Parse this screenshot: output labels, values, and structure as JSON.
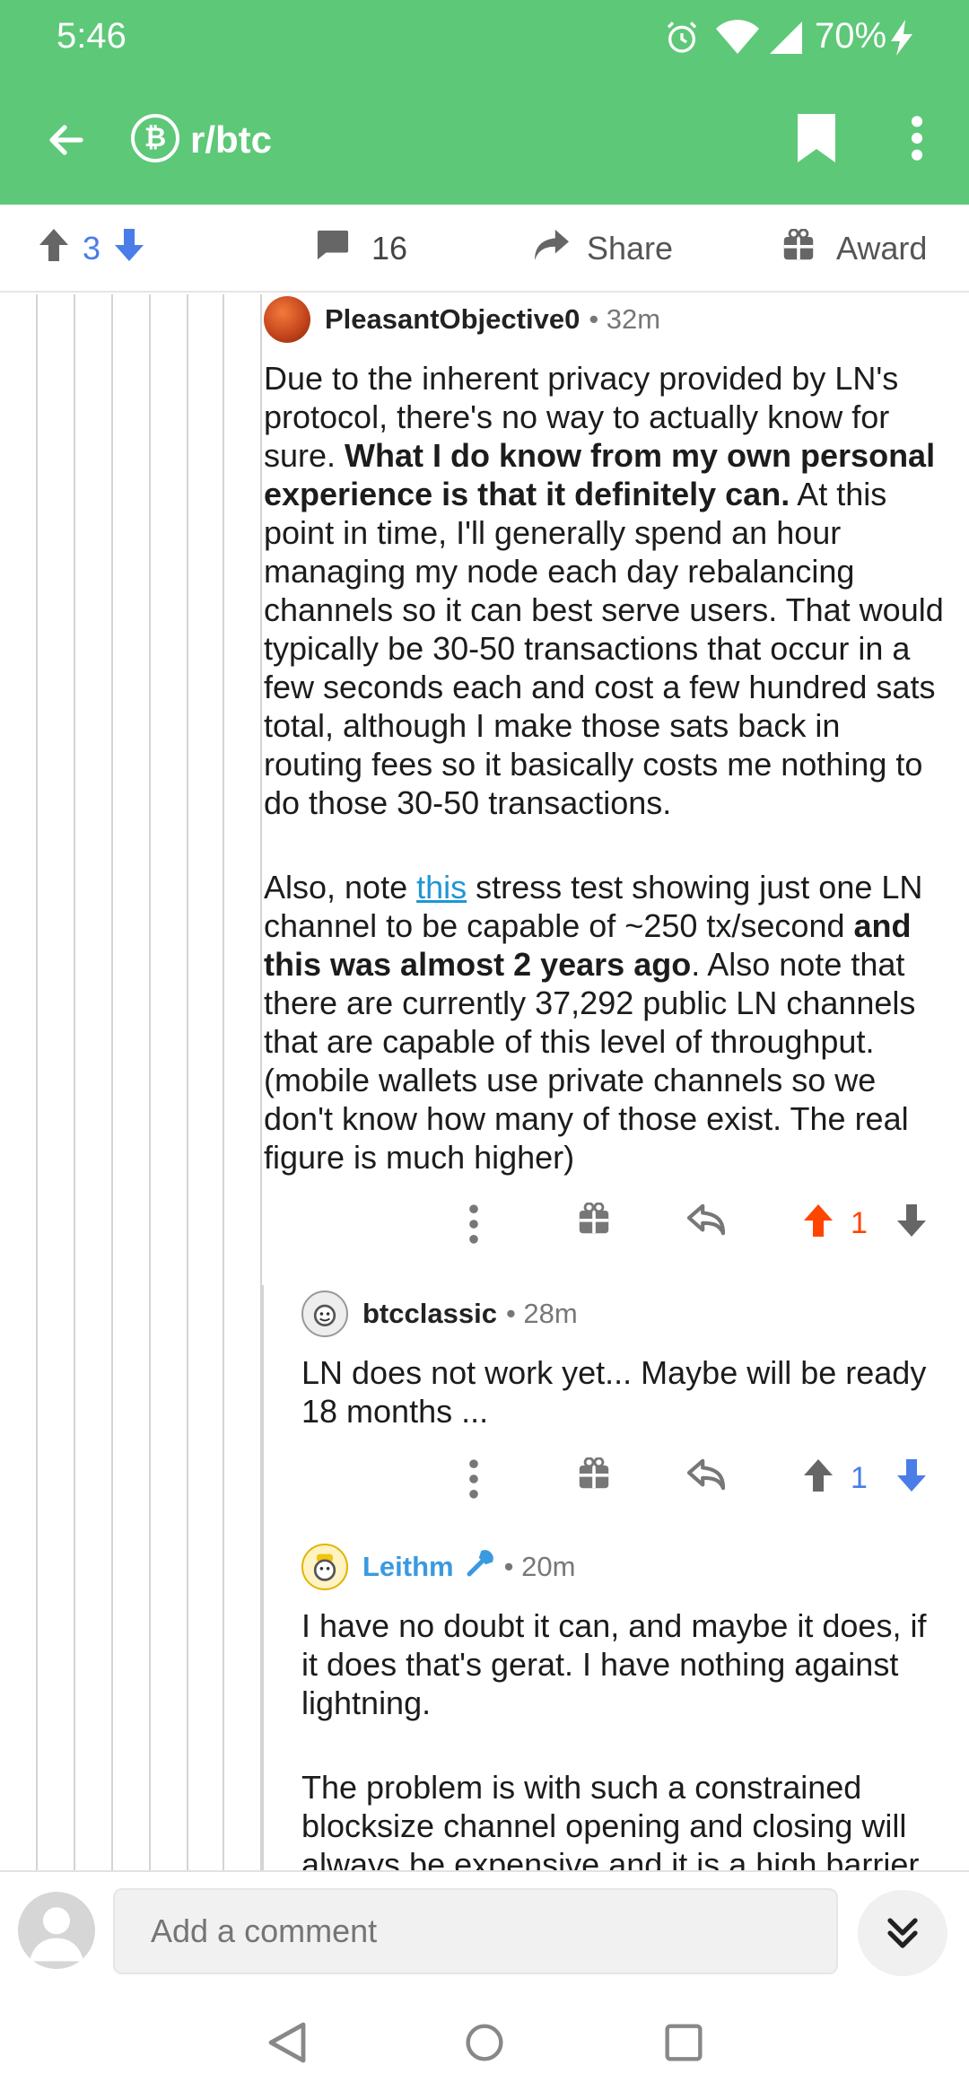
{
  "status_bar": {
    "time": "5:46",
    "battery": "70%"
  },
  "app_bar": {
    "subreddit": "r/btc",
    "sub_icon_glyph": "₿"
  },
  "post_actions": {
    "upvotes": "3",
    "comments": "16",
    "share_label": "Share",
    "award_label": "Award"
  },
  "comments": [
    {
      "author": "PleasantObjective0",
      "meta": "• 32m",
      "paragraphs": [
        {
          "runs": [
            {
              "t": "Due to the inherent privacy provided by LN's protocol, there's no way to actually know for sure.  "
            },
            {
              "t": "What I do know from my own personal experience is that it definitely can.",
              "b": true
            },
            {
              "t": "  At this point in time, I'll generally spend an hour managing my node each day rebalancing channels so it can best serve users. That would typically be 30-50 transactions that occur in a few seconds each and cost a few hundred sats total, although I make those sats back in routing fees so it basically costs me nothing to do those 30-50 transactions."
            }
          ]
        },
        {
          "runs": [
            {
              "t": "Also, note "
            },
            {
              "t": "this",
              "link": true
            },
            {
              "t": " stress test showing just one LN channel to be capable of ~250 tx/second "
            },
            {
              "t": "and this was almost 2 years ago",
              "b": true
            },
            {
              "t": ". Also note that there are currently 37,292 public LN channels that are capable of this level of throughput. (mobile wallets use private channels so we don't know how many of those exist.  The real figure is much higher)"
            }
          ]
        }
      ],
      "score": "1",
      "vote_state": "up"
    },
    {
      "author": "btcclassic",
      "meta": "• 28m",
      "paragraphs": [
        {
          "runs": [
            {
              "t": "LN does not work yet... Maybe will be ready 18 months ..."
            }
          ]
        }
      ],
      "score": "1",
      "vote_state": "down"
    },
    {
      "author": "Leithm",
      "meta": "• 20m",
      "paragraphs": [
        {
          "runs": [
            {
              "t": "I have no doubt it can, and maybe it does, if it does that's gerat. I have nothing against lightning."
            }
          ]
        },
        {
          "runs": [
            {
              "t": "The problem is with such a constrained blocksize channel opening and closing will always be expensive and it is a high barrier"
            }
          ]
        }
      ]
    }
  ],
  "composer": {
    "placeholder": "Add a comment"
  },
  "colors": {
    "header": "#5dc878",
    "upvote_active": "#ff4500",
    "downvote_active": "#4a7de8",
    "link": "#1f96d8",
    "mod": "#3a9ae0"
  },
  "icons": [
    "back-arrow-icon",
    "bookmark-icon",
    "more-vert-icon",
    "upvote-icon",
    "downvote-icon",
    "comment-icon",
    "share-icon",
    "gift-icon",
    "reply-icon",
    "chevron-down-double-icon",
    "nav-back-icon",
    "nav-home-icon",
    "nav-recents-icon"
  ]
}
